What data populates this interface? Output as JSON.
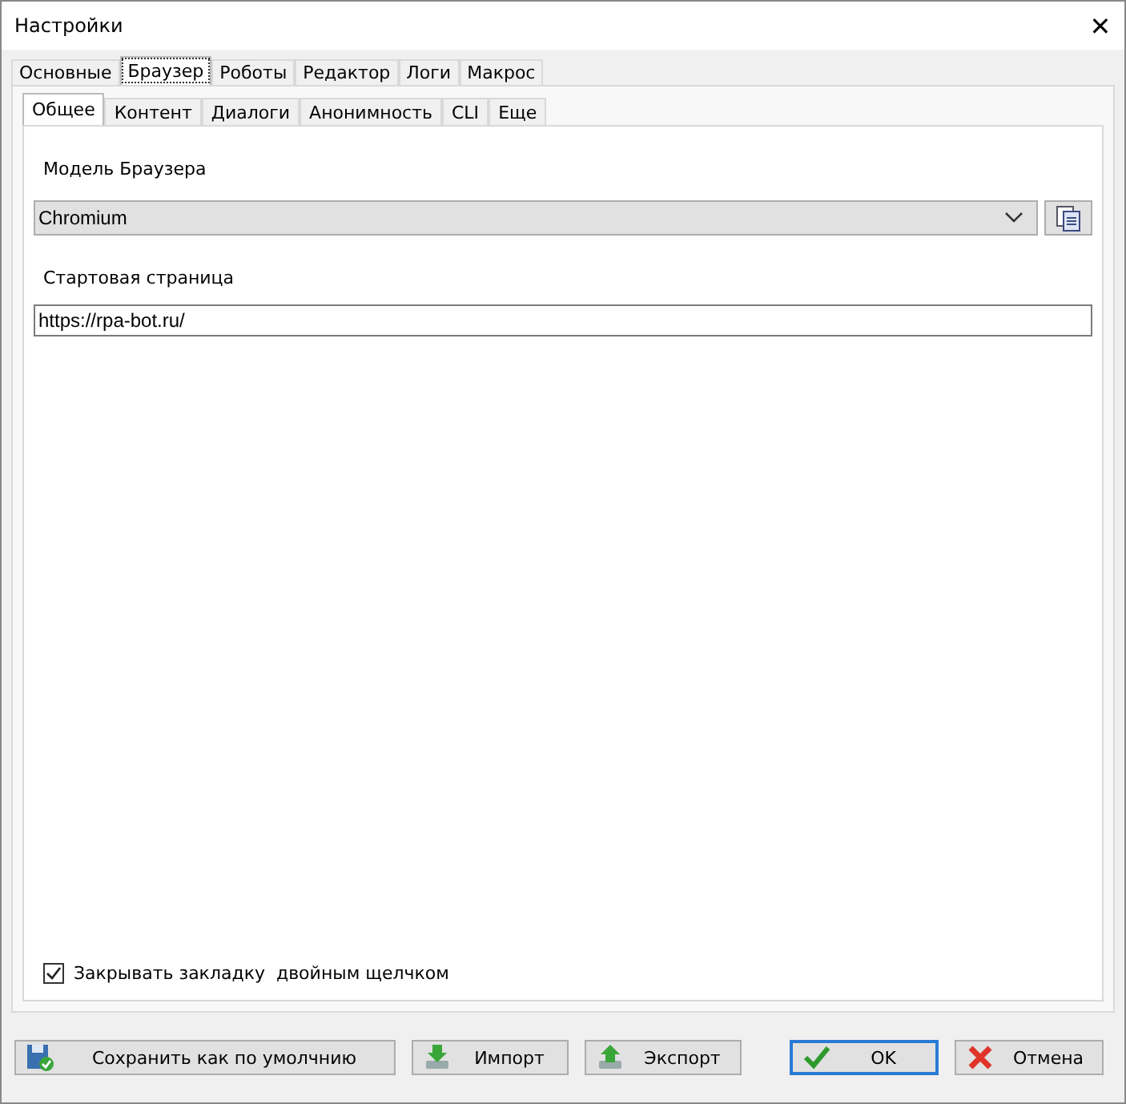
{
  "window": {
    "title": "Настройки",
    "close": "✕"
  },
  "tabs": [
    {
      "label": "Основные",
      "selected": false
    },
    {
      "label": "Браузер",
      "selected": true
    },
    {
      "label": "Роботы",
      "selected": false
    },
    {
      "label": "Редактор",
      "selected": false
    },
    {
      "label": "Логи",
      "selected": false
    },
    {
      "label": "Макрос",
      "selected": false
    }
  ],
  "subtabs": [
    {
      "label": "Общее",
      "selected": true
    },
    {
      "label": "Контент",
      "selected": false
    },
    {
      "label": "Диалоги",
      "selected": false
    },
    {
      "label": "Анонимность",
      "selected": false
    },
    {
      "label": "CLI",
      "selected": false
    },
    {
      "label": "Еще",
      "selected": false
    }
  ],
  "browser_model": {
    "label": "Модель Браузера",
    "value": "Chromium"
  },
  "start_page": {
    "label": "Стартовая страница",
    "value": "https://rpa-bot.ru/"
  },
  "close_tab_option": {
    "label": "Закрывать закладку  двойным щелчком",
    "checked": true
  },
  "buttons": [
    {
      "kind": "save",
      "label": "Сохранить как по умолчнию",
      "default": false
    },
    {
      "kind": "import",
      "label": "Импорт",
      "default": false
    },
    {
      "kind": "export",
      "label": "Экспорт",
      "default": false
    },
    {
      "kind": "ok",
      "label": "OK",
      "default": true
    },
    {
      "kind": "cancel",
      "label": "Отмена",
      "default": false
    }
  ]
}
